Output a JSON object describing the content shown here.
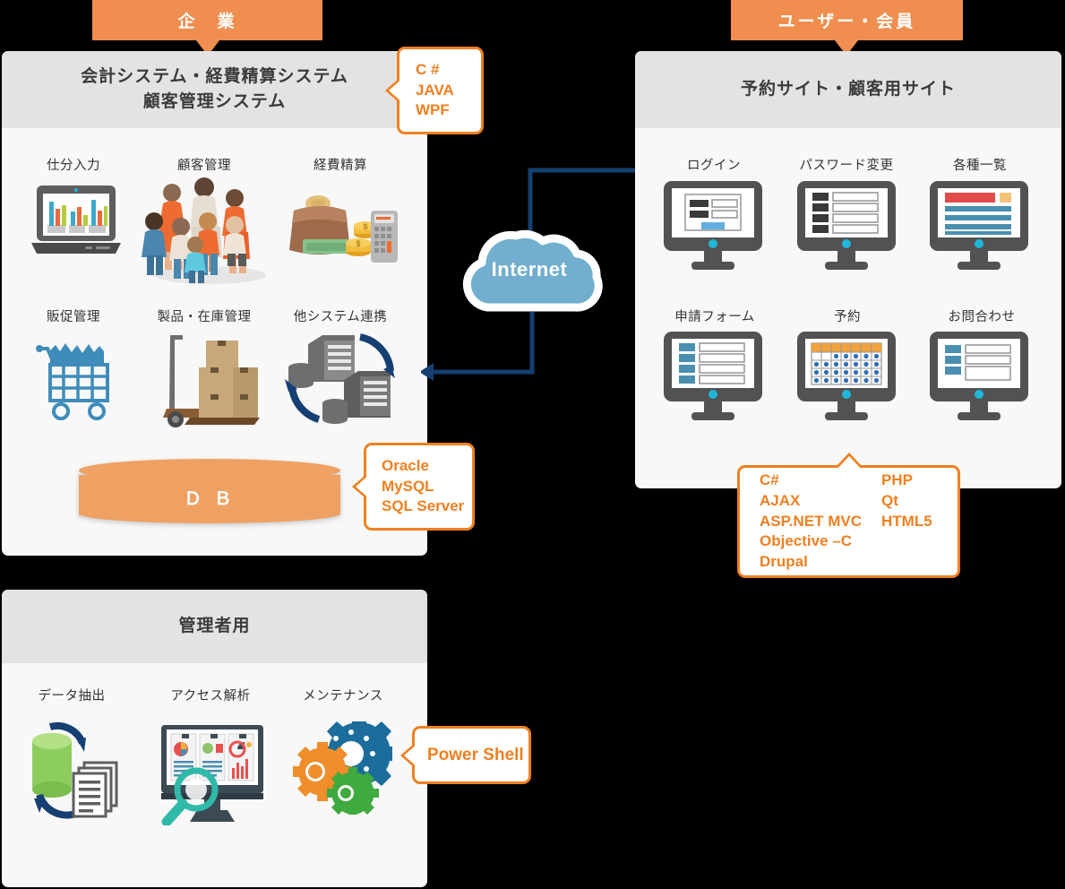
{
  "tabs": [
    {
      "label": "企　業"
    },
    {
      "label": "ユーザー・会員"
    }
  ],
  "panels": {
    "enterprise": {
      "title_line1": "会計システム・経費精算システム",
      "title_line2": "顧客管理システム",
      "items": [
        {
          "label": "仕分入力",
          "icon": "laptop-chart-icon"
        },
        {
          "label": "顧客管理",
          "icon": "people-group-icon"
        },
        {
          "label": "経費精算",
          "icon": "wallet-calculator-icon"
        },
        {
          "label": "販促管理",
          "icon": "shopping-cart-icon"
        },
        {
          "label": "製品・在庫管理",
          "icon": "boxes-handtruck-icon"
        },
        {
          "label": "他システム連携",
          "icon": "servers-sync-icon"
        }
      ],
      "db_label": "Ｄ Ｂ"
    },
    "user": {
      "title": "予約サイト・顧客用サイト",
      "items": [
        {
          "label": "ログイン",
          "icon": "monitor-login-icon"
        },
        {
          "label": "パスワード変更",
          "icon": "monitor-list-icon"
        },
        {
          "label": "各種一覧",
          "icon": "monitor-table-icon"
        },
        {
          "label": "申請フォーム",
          "icon": "monitor-form-icon"
        },
        {
          "label": "予約",
          "icon": "monitor-calendar-icon"
        },
        {
          "label": "お問合わせ",
          "icon": "monitor-contact-icon"
        }
      ]
    },
    "admin": {
      "title": "管理者用",
      "items": [
        {
          "label": "データ抽出",
          "icon": "database-documents-icon"
        },
        {
          "label": "アクセス解析",
          "icon": "monitor-magnifier-icon"
        },
        {
          "label": "メンテナンス",
          "icon": "gears-icon"
        }
      ]
    }
  },
  "callouts": {
    "enterprise_tech": {
      "lines": [
        "C #",
        "JAVA",
        "WPF"
      ]
    },
    "db_tech": {
      "lines": [
        "Oracle",
        "MySQL",
        "SQL Server"
      ]
    },
    "web_tech": {
      "col1": [
        "C#",
        "AJAX",
        "ASP.NET MVC",
        "Objective –C",
        "Drupal"
      ],
      "col2": [
        "PHP",
        "Qt",
        "HTML5"
      ]
    },
    "admin_tech": {
      "lines": [
        "Power Shell"
      ]
    }
  },
  "network": {
    "cloud_label": "Internet"
  },
  "colors": {
    "orange_tab": "#ef8e4f",
    "orange_accent": "#ef8021",
    "panel_head": "#e3e3e3",
    "panel_body": "#f8f8f8",
    "cloud": "#72aecd",
    "arrow": "#163f72",
    "db": "#efa163"
  }
}
